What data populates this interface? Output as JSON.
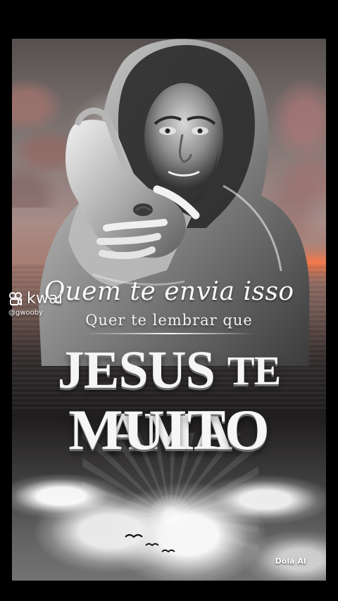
{
  "watermark": {
    "brand": "kwai",
    "handle": "@gwooby",
    "icon": "kwai-logo-icon"
  },
  "poster": {
    "line1": "Quem te envia isso",
    "line2": "Quer te lembrar que",
    "line3_main": "JESUS",
    "line3_small": "TE",
    "line3_end": "AMA",
    "line4": "MUITO",
    "credit": "Dola AI"
  },
  "colors": {
    "background": "#000000",
    "text": "#f5f5f5",
    "sunset_accent": "#ff7a4a"
  }
}
